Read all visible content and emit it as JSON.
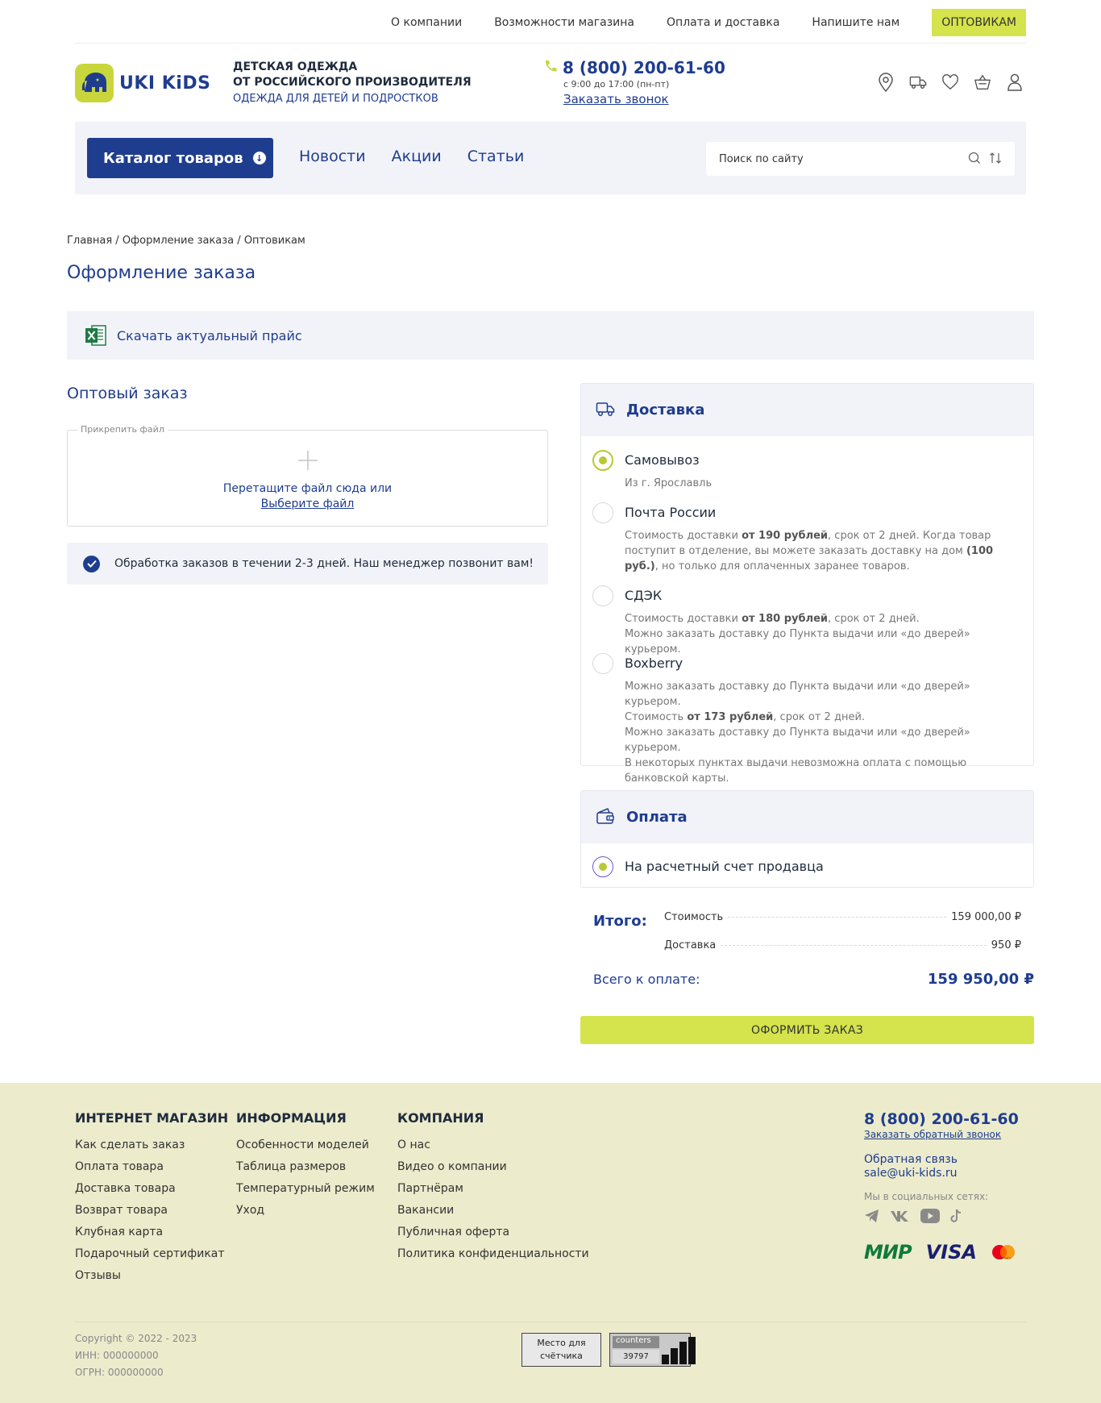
{
  "topnav": {
    "items": [
      "О компании",
      "Возможности магазина",
      "Оплата и доставка",
      "Напишите нам"
    ],
    "wholesale": "ОПТОВИКАМ"
  },
  "header": {
    "logo": "UKI KiDS",
    "tagline1": "ДЕТСКАЯ ОДЕЖДА",
    "tagline2": "ОТ РОССИЙСКОГО ПРОИЗВОДИТЕЛЯ",
    "tagline3": "ОДЕЖДА ДЛЯ ДЕТЕЙ И ПОДРОСТКОВ",
    "phone": "8 (800) 200-61-60",
    "hours": "с 9:00 до 17:00 (пн-пт)",
    "callback": "Заказать звонок",
    "icons": [
      "location-icon",
      "truck-icon",
      "heart-icon",
      "basket-icon",
      "user-icon"
    ]
  },
  "navbar": {
    "catalog": "Каталог товаров",
    "links": [
      "Новости",
      "Акции",
      "Статьи"
    ],
    "search_placeholder": "Поиск по сайту"
  },
  "breadcrumb": {
    "items": [
      "Главная",
      "Оформление заказа",
      "Оптовикам"
    ],
    "separator": "/"
  },
  "page": {
    "title": "Оформление заказа",
    "price_link": "Скачать актуальный прайс",
    "wholesale_title": "Оптовый заказ",
    "attach_legend": "Прикрепить файл",
    "drop_text": "Перетащите файл сюда или",
    "choose_file": "Выберите файл",
    "notice": "Обработка заказов в течении 2-3 дней. Наш менеджер позвонит вам!"
  },
  "delivery": {
    "title": "Доставка",
    "options": [
      {
        "name": "Самовывоз",
        "selected": true,
        "desc": "Из г. Ярославль"
      },
      {
        "name": "Почта России",
        "selected": false,
        "desc_parts": [
          "Стоимость доставки ",
          "от 190 рублей",
          ", срок от 2 дней. Когда товар поступит в отделение, вы можете заказать доставку на дом ",
          "(100 руб.)",
          ", но только для оплаченных заранее товаров."
        ]
      },
      {
        "name": "СДЭК",
        "selected": false,
        "desc_parts": [
          "Стоимость доставки ",
          "от 180 рублей",
          ", срок от 2 дней.",
          "Можно заказать доставку до Пункта выдачи или «до дверей» курьером."
        ]
      },
      {
        "name": "Boxberry",
        "selected": false,
        "desc_parts": [
          "Можно заказать доставку до Пункта выдачи или «до дверей» курьером.",
          "Стоимость ",
          "от 173 рублей",
          ", срок от 2 дней.",
          "Можно заказать доставку до Пункта выдачи или «до дверей» курьером.",
          "В некоторых пунктах выдачи невозможна оплата с помощью банковской карты."
        ]
      }
    ]
  },
  "payment": {
    "title": "Оплата",
    "option": "На расчетный счет продавца",
    "selected": true
  },
  "totals": {
    "label": "Итого:",
    "cost_label": "Стоимость",
    "cost_value": "159 000,00 ₽",
    "delivery_label": "Доставка",
    "delivery_value": "950 ₽",
    "grand_label": "Всего к оплате:",
    "grand_value": "159 950,00 ₽",
    "submit": "ОФОРМИТЬ ЗАКАЗ"
  },
  "footer": {
    "col1": {
      "title": "ИНТЕРНЕТ МАГАЗИН",
      "links": [
        "Как сделать заказ",
        "Оплата товара",
        "Доставка товара",
        "Возврат товара",
        "Клубная карта",
        "Подарочный сертификат",
        "Отзывы"
      ]
    },
    "col2": {
      "title": "ИНФОРМАЦИЯ",
      "links": [
        "Особенности моделей",
        "Таблица размеров",
        "Температурный режим",
        "Уход"
      ]
    },
    "col3": {
      "title": "КОМПАНИЯ",
      "links": [
        "О нас",
        "Видео о компании",
        "Партнёрам",
        "Вакансии",
        "Публичная оферта",
        "Политика конфиденциальности"
      ]
    },
    "phone": "8 (800) 200-61-60",
    "callback": "Заказать обратный звонок",
    "feedback": "Обратная связь",
    "email": "sale@uki-kids.ru",
    "socials_label": "Мы в социальных сетях:",
    "socials": [
      "telegram-icon",
      "vk-icon",
      "youtube-icon",
      "tiktok-icon"
    ],
    "payments": [
      "МИР",
      "VISA",
      "mastercard"
    ],
    "copyright": "Copyright © 2022 - 2023",
    "inn": "ИНН: 000000000",
    "ogrn": "ОГРН: 000000000",
    "counter_placeholder": "Место для счётчика",
    "counter_label": "counters",
    "counter_value": "39797"
  },
  "colors": {
    "brand_blue": "#1f3d8f",
    "accent_lime": "#d5e34c",
    "panel_bg": "#f2f3f8",
    "footer_bg": "#ecebcc"
  }
}
